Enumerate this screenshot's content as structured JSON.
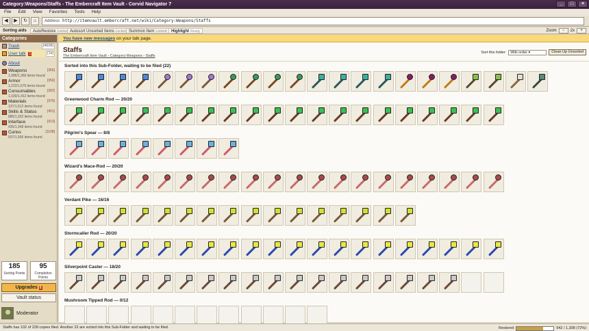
{
  "window": {
    "title": "Category:Weapons/Staffs - The Embercraft Item Vault - Corvid Navigator 7"
  },
  "menu": [
    "File",
    "Edit",
    "View",
    "Favorites",
    "Tools",
    "Help"
  ],
  "nav": {
    "address_label": "Address",
    "url": "http://itemvault.embercraft.net/wiki/Category:Weapons/Staffs"
  },
  "toolbar": {
    "sorting_aids": "Sorting aids",
    "items": [
      {
        "label": "AutoRestore",
        "state": "Locked"
      },
      {
        "label": "Autosort Unsorted Items",
        "state": "Locked"
      },
      {
        "label": "Summon Item",
        "state": "Locked"
      },
      {
        "label": "Highlight",
        "state": "Ready"
      }
    ],
    "zoom_label": "Zoom",
    "zoom_value": "2x"
  },
  "sidebar": {
    "header": "Categories",
    "trash": {
      "label": "Trash",
      "count": "[4608]"
    },
    "user_talk": {
      "label": "User talk",
      "badge": "1",
      "count": "[1k]"
    },
    "about": "About",
    "categories": [
      {
        "name": "Weapons",
        "count": "[366]",
        "sub": "1,086/1,366 items found"
      },
      {
        "name": "Armor",
        "count": "[356]",
        "sub": "1,222/1,576 items found"
      },
      {
        "name": "Consumables",
        "count": "[382]",
        "sub": "1,030/1,412 items found"
      },
      {
        "name": "Materials",
        "count": "[975]",
        "sub": "137/1,512 items found"
      },
      {
        "name": "Skills & Status",
        "count": "[451]",
        "sub": "885/1,332 items found"
      },
      {
        "name": "Interface",
        "count": "[913]",
        "sub": "435/1,348 items found"
      },
      {
        "name": "Curios",
        "count": "[1108]",
        "sub": "507/1,596 items found"
      }
    ],
    "points": [
      {
        "value": "185",
        "label": "Sorting Points"
      },
      {
        "value": "95",
        "label": "Completion Points"
      }
    ],
    "upgrades": {
      "label": "Upgrades",
      "badge": "5"
    },
    "vault_status": "Vault status",
    "user_role": "Moderator"
  },
  "main": {
    "notice_link": "You have new messages",
    "notice_rest": "on your talk page.",
    "title": "Staffs",
    "breadcrumb": "The Embercraft Item Vault › Category:Weapons › Staffs",
    "sort_label": "Sort this folder:",
    "sort_value": "Wiki order",
    "cleanup_button": "Clean Up Unsorted",
    "sections": [
      {
        "title": "Sorted into this Sub-Folder, waiting to be filed (22)",
        "filled": 22,
        "total": 22,
        "items": [
          {
            "shaft": "#6b4a2a",
            "head": "#4a8ad8",
            "sq": true
          },
          {
            "shaft": "#6b4a2a",
            "head": "#4a8ad8",
            "sq": true
          },
          {
            "shaft": "#6b4a2a",
            "head": "#4a8ad8",
            "sq": true
          },
          {
            "shaft": "#6b4a2a",
            "head": "#4a8ad8",
            "sq": true
          },
          {
            "shaft": "#7a5a3a",
            "head": "#a07ad0",
            "sq": false
          },
          {
            "shaft": "#7a5a3a",
            "head": "#a07ad0",
            "sq": false
          },
          {
            "shaft": "#7a5a3a",
            "head": "#a07ad0",
            "sq": false
          },
          {
            "shaft": "#7a4a22",
            "head": "#3a9a5a",
            "sq": false
          },
          {
            "shaft": "#7a4a22",
            "head": "#3a9a5a",
            "sq": false
          },
          {
            "shaft": "#7a4a22",
            "head": "#3a9a5a",
            "sq": false
          },
          {
            "shaft": "#7a4a22",
            "head": "#3a9a5a",
            "sq": false
          },
          {
            "shaft": "#2a5a5a",
            "head": "#3ab0a0",
            "sq": true
          },
          {
            "shaft": "#2a5a5a",
            "head": "#3ab0a0",
            "sq": true
          },
          {
            "shaft": "#2a5a5a",
            "head": "#3ab0a0",
            "sq": true
          },
          {
            "shaft": "#2a5a5a",
            "head": "#3ab0a0",
            "sq": true
          },
          {
            "shaft": "#c07a1a",
            "head": "#8a1a6a",
            "sq": false
          },
          {
            "shaft": "#c07a1a",
            "head": "#8a1a6a",
            "sq": false
          },
          {
            "shaft": "#c07a1a",
            "head": "#8a1a6a",
            "sq": false
          },
          {
            "shaft": "#5a4a2a",
            "head": "#8ac04a",
            "sq": true
          },
          {
            "shaft": "#5a4a2a",
            "head": "#8ac04a",
            "sq": true
          },
          {
            "shaft": "#8a6a3a",
            "head": "#e0e0d0",
            "sq": true
          },
          {
            "shaft": "#3a4a3a",
            "head": "#5a8a7a",
            "sq": true
          }
        ]
      },
      {
        "title": "Greenwood Charm Rod — 20/20",
        "filled": 20,
        "total": 20,
        "shaft": "#6b3a2a",
        "head": "#3ac050",
        "sq": true
      },
      {
        "title": "Pilgrim's Spear — 8/8",
        "filled": 8,
        "total": 8,
        "shaft": "#d05a6a",
        "head": "#6ab0e0",
        "sq": true
      },
      {
        "title": "Wizard's Mace-Rod — 20/20",
        "filled": 20,
        "total": 20,
        "shaft": "#c86a6a",
        "head": "#a84a4a",
        "sq": false
      },
      {
        "title": "Verdant Pike — 16/16",
        "filled": 16,
        "total": 16,
        "shaft": "#7a5a3a",
        "head": "#d0e030",
        "sq": true
      },
      {
        "title": "Stormcaller Rod — 20/20",
        "filled": 20,
        "total": 20,
        "shaft": "#2a4ab0",
        "head": "#e8e840",
        "sq": true
      },
      {
        "title": "Silverpoint Caster — 18/20",
        "filled": 18,
        "total": 20,
        "shaft": "#6a4a3a",
        "head": "#c8c8c8",
        "sq": true
      },
      {
        "title": "Mushroom Tipped Rod — 0/12",
        "filled": 0,
        "total": 12,
        "shaft": "#6a4a3a",
        "head": "#c84a4a",
        "sq": false
      }
    ]
  },
  "status": {
    "text": "Staffs has 102 of 228 copies filed. Another 22 are sorted into this Sub-Folder and waiting to be filed.",
    "restored_label": "Restored",
    "restored_value": "942 / 1,308 (72%)",
    "restored_fraction": 0.72
  }
}
